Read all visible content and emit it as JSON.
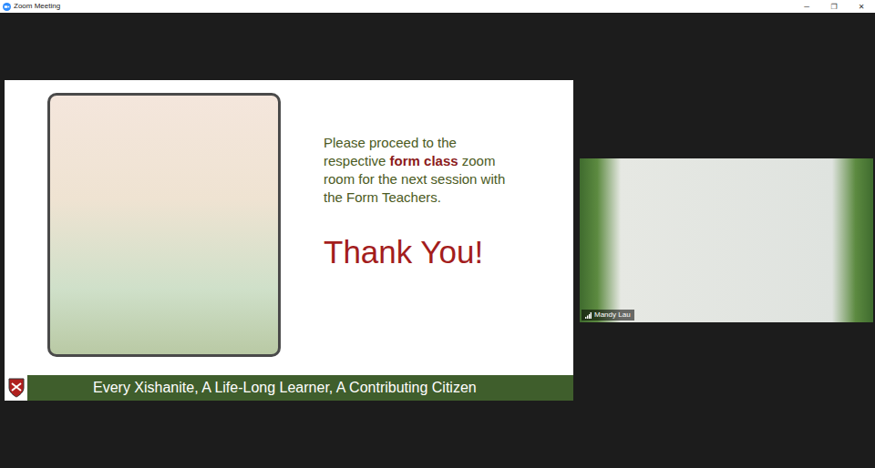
{
  "window": {
    "title": "Zoom Meeting",
    "controls": [
      "─",
      "❐",
      "✕"
    ]
  },
  "slide": {
    "instruction": [
      {
        "text": "Please proceed to the respective ",
        "emphasis": false
      },
      {
        "text": "form class",
        "emphasis": true
      },
      {
        "text": " zoom room for the next session with the Form Teachers.",
        "emphasis": false
      }
    ],
    "closing": "Thank You!",
    "motto": "Every Xishanite, A Life-Long Learner, A Contributing Citizen"
  },
  "participant": {
    "name": "Mandy Lau"
  }
}
